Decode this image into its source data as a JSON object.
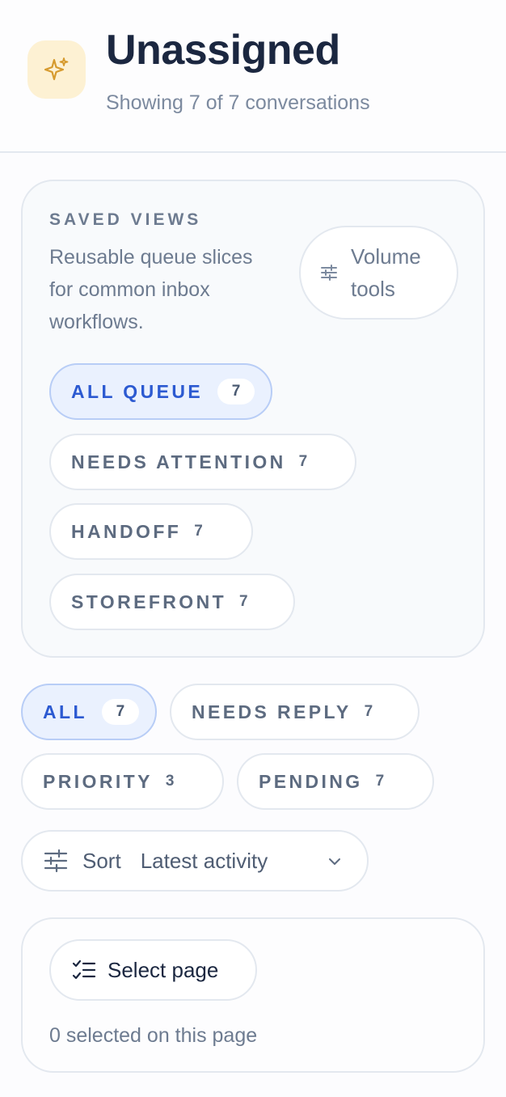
{
  "header": {
    "icon": "sparkle-icon",
    "icon_color": "#d69a2d",
    "title": "Unassigned",
    "subtitle": "Showing 7 of 7 conversations"
  },
  "saved_views": {
    "eyebrow": "SAVED VIEWS",
    "description": "Reusable queue slices for common inbox workflows.",
    "volume_button": {
      "label": "Volume tools",
      "icon": "sliders-icon"
    },
    "views": [
      {
        "label": "ALL QUEUE",
        "count": "7",
        "active": true
      },
      {
        "label": "NEEDS ATTENTION",
        "count": "7",
        "active": false
      },
      {
        "label": "HANDOFF",
        "count": "7",
        "active": false
      },
      {
        "label": "STOREFRONT",
        "count": "7",
        "active": false
      }
    ]
  },
  "filters": [
    {
      "label": "ALL",
      "count": "7",
      "active": true
    },
    {
      "label": "NEEDS REPLY",
      "count": "7",
      "active": false
    },
    {
      "label": "PRIORITY",
      "count": "3",
      "active": false
    },
    {
      "label": "PENDING",
      "count": "7",
      "active": false
    }
  ],
  "sort": {
    "label": "Sort",
    "value": "Latest activity",
    "icon": "sliders-icon"
  },
  "selection": {
    "button_label": "Select page",
    "icon": "checklist-icon",
    "status": "0 selected on this page"
  },
  "colors": {
    "accent": "#2c5ad1",
    "accent_bg": "#eaf1fe",
    "border": "#e3e8ef",
    "muted_text": "#6d7b90"
  }
}
